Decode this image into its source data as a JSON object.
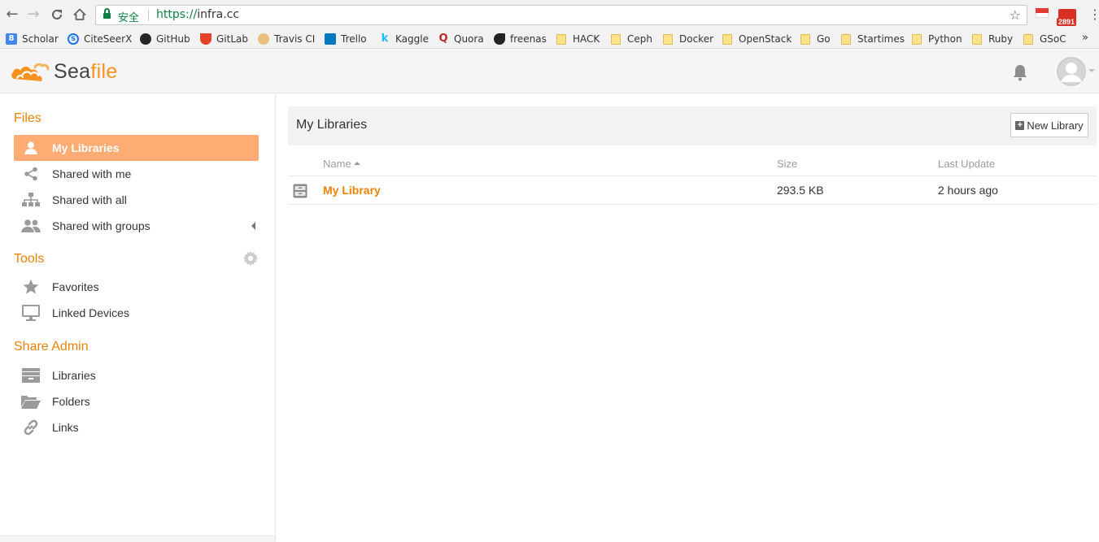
{
  "browser": {
    "back_icon": "arrow-left-icon",
    "forward_icon": "arrow-right-icon",
    "reload_icon": "reload-icon",
    "home_icon": "home-icon",
    "secure_label": "安全",
    "url_scheme": "https://",
    "url_host": "infra.cc",
    "bookmark_star_icon": "star-icon",
    "mail_badge": "2891",
    "bookmarks": [
      {
        "label": "Scholar",
        "icon": "scholar-icon",
        "color": "#4285f4"
      },
      {
        "label": "CiteSeerX",
        "icon": "citeseerx-icon",
        "color": "#1a73e8"
      },
      {
        "label": "GitHub",
        "icon": "github-icon",
        "color": "#24292e"
      },
      {
        "label": "GitLab",
        "icon": "gitlab-icon",
        "color": "#e24329"
      },
      {
        "label": "Travis CI",
        "icon": "travis-icon",
        "color": "#c0392b"
      },
      {
        "label": "Trello",
        "icon": "trello-icon",
        "color": "#0079bf"
      },
      {
        "label": "Kaggle",
        "icon": "kaggle-icon",
        "color": "#20beff"
      },
      {
        "label": "Quora",
        "icon": "quora-icon",
        "color": "#b92b27"
      },
      {
        "label": "freenas",
        "icon": "freenas-icon",
        "color": "#222222"
      },
      {
        "label": "HACK",
        "icon": "folder-icon"
      },
      {
        "label": "Ceph",
        "icon": "folder-icon"
      },
      {
        "label": "Docker",
        "icon": "folder-icon"
      },
      {
        "label": "OpenStack",
        "icon": "folder-icon"
      },
      {
        "label": "Go",
        "icon": "folder-icon"
      },
      {
        "label": "Startimes",
        "icon": "folder-icon"
      },
      {
        "label": "Python",
        "icon": "folder-icon"
      },
      {
        "label": "Ruby",
        "icon": "folder-icon"
      },
      {
        "label": "GSoC",
        "icon": "folder-icon"
      }
    ],
    "more_label": "»"
  },
  "header": {
    "logo_text_a": "Sea",
    "logo_text_b": "file",
    "bell_icon": "bell-icon",
    "avatar_icon": "user-avatar-icon",
    "brand_color": "#f7931e"
  },
  "sidebar": {
    "files_title": "Files",
    "files_items": [
      {
        "label": "My Libraries",
        "icon": "user-icon",
        "active": true
      },
      {
        "label": "Shared with me",
        "icon": "share-icon"
      },
      {
        "label": "Shared with all",
        "icon": "sitemap-icon"
      },
      {
        "label": "Shared with groups",
        "icon": "group-icon"
      }
    ],
    "tools_title": "Tools",
    "tools_items": [
      {
        "label": "Favorites",
        "icon": "star-icon"
      },
      {
        "label": "Linked Devices",
        "icon": "monitor-icon"
      }
    ],
    "share_admin_title": "Share Admin",
    "share_admin_items": [
      {
        "label": "Libraries",
        "icon": "archive-icon"
      },
      {
        "label": "Folders",
        "icon": "folder-open-icon"
      },
      {
        "label": "Links",
        "icon": "link-icon"
      }
    ],
    "accent_color": "#eb8205",
    "active_bg": "#feac74"
  },
  "main": {
    "title": "My Libraries",
    "new_library_label": "New Library",
    "columns": {
      "name": "Name",
      "size": "Size",
      "last_update": "Last Update"
    },
    "rows": [
      {
        "name": "My Library",
        "size": "293.5 KB",
        "last_update": "2 hours ago",
        "icon": "library-icon"
      }
    ]
  }
}
